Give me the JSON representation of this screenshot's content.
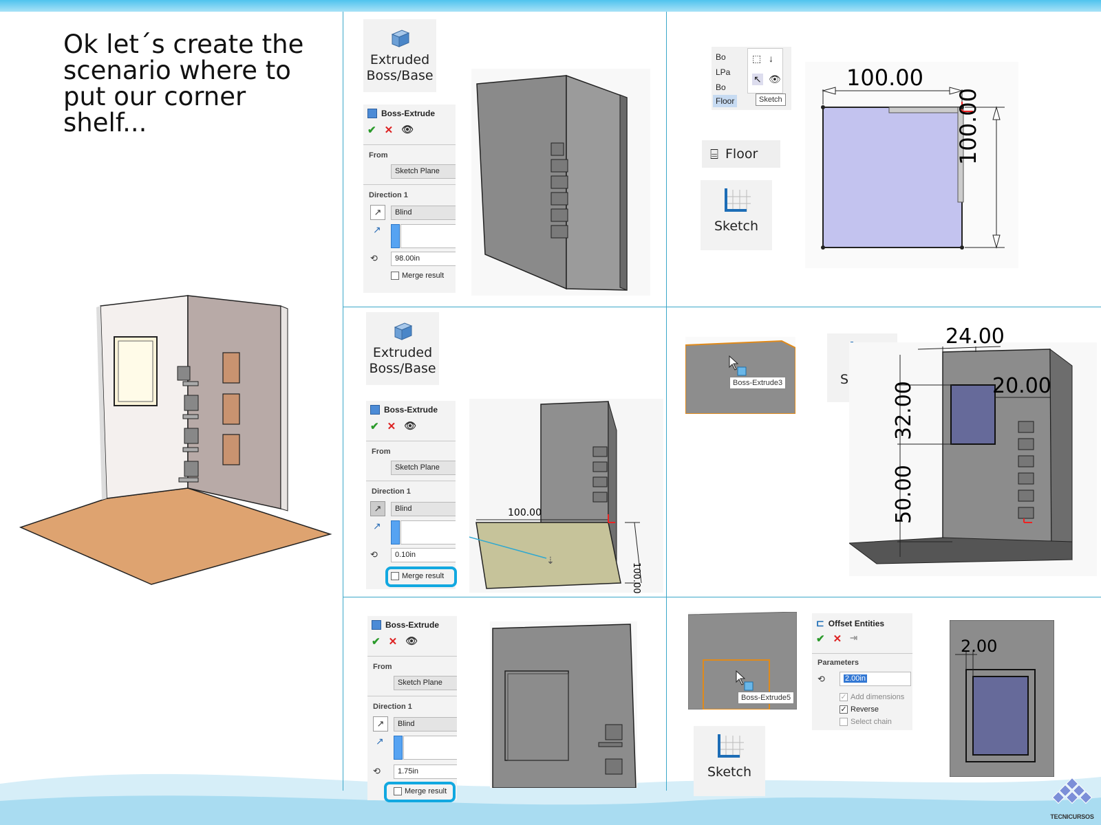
{
  "slide": {
    "title": "Ok let´s create the scenario where to put our corner shelf...",
    "logo_text": "TECNICURSOS"
  },
  "toolbar": {
    "extruded_boss_line1": "Extruded",
    "extruded_boss_line2": "Boss/Base",
    "sketch_label": "Sketch",
    "floor_label": "Floor"
  },
  "boss_extrude_1": {
    "title": "Boss-Extrude",
    "from_label": "From",
    "from_value": "Sketch Plane",
    "direction_label": "Direction 1",
    "end_condition": "Blind",
    "depth": "98.00in",
    "merge_label": "Merge result"
  },
  "boss_extrude_2": {
    "title": "Boss-Extrude",
    "from_label": "From",
    "from_value": "Sketch Plane",
    "direction_label": "Direction 1",
    "end_condition": "Blind",
    "depth": "0.10in",
    "merge_label": "Merge result"
  },
  "boss_extrude_3": {
    "title": "Boss-Extrude",
    "from_label": "From",
    "from_value": "Sketch Plane",
    "direction_label": "Direction 1",
    "end_condition": "Blind",
    "depth": "1.75in",
    "merge_label": "Merge result"
  },
  "feature_tree": {
    "items": [
      "Bo",
      "LPa",
      "Bo",
      "Floor"
    ],
    "tooltip": "Sketch"
  },
  "floor_sketch": {
    "dim_horizontal": "100.00",
    "dim_vertical": "100.00"
  },
  "floor_extrude": {
    "dim": "100.00",
    "dim_side": "100.00"
  },
  "face_tooltips": {
    "face1": "Boss-Extrude3",
    "face2": "Boss-Extrude5"
  },
  "window_sketch": {
    "dim_width": "24.00",
    "dim_offset": "20.00",
    "dim_height": "32.00",
    "dim_bottom": "50.00"
  },
  "offset_entities": {
    "title": "Offset Entities",
    "params_label": "Parameters",
    "distance": "2.00in",
    "add_dimensions": "Add dimensions",
    "reverse": "Reverse",
    "select_chain": "Select chain",
    "frame_dim": "2.00"
  },
  "colors": {
    "accent": "#12a8e0",
    "divider": "#3aa7c9",
    "sketch_fill": "#c3c3ef",
    "floor_orange": "#dea370",
    "wall_gray": "#8c8c8c"
  }
}
